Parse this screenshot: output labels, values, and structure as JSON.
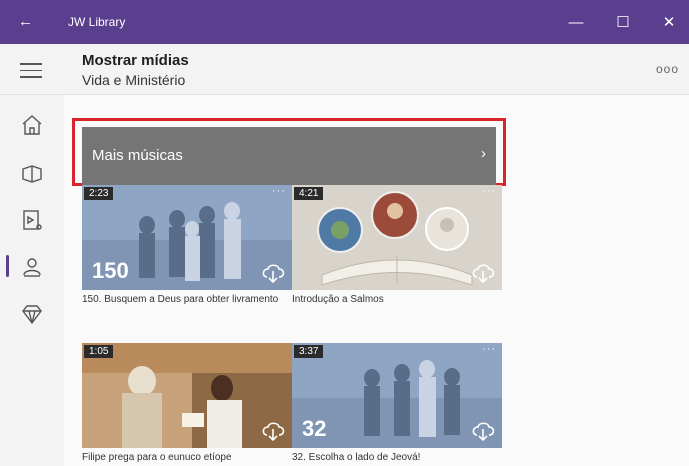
{
  "window": {
    "title": "JW Library",
    "back_glyph": "←",
    "minimize_glyph": "—",
    "maximize_glyph": "☐",
    "close_glyph": "✕"
  },
  "header": {
    "title": "Mostrar mídias",
    "subtitle": "Vida e Ministério",
    "more_glyph": "ooo"
  },
  "sidebar": {
    "items": [
      "home-icon",
      "bible-icon",
      "media-icon",
      "meetings-icon",
      "diamond-icon"
    ],
    "selected_index": 3,
    "accent": "#5b3f8f"
  },
  "more_music": {
    "label": "Mais músicas",
    "chevron": "›"
  },
  "videos": [
    {
      "duration": "2:23",
      "number": "150",
      "caption": "150. Busquem a Deus para obter livramento"
    },
    {
      "duration": "4:21",
      "number": "",
      "caption": "Introdução a Salmos"
    },
    {
      "duration": "1:05",
      "number": "",
      "caption": "Filipe prega para o eunuco etíope"
    },
    {
      "duration": "3:37",
      "number": "32",
      "caption": "32. Escolha o lado de Jeová!"
    }
  ],
  "colors": {
    "titlebar": "#5b3f8f",
    "highlight_border": "#d9242b",
    "more_button_bg": "#757575"
  }
}
